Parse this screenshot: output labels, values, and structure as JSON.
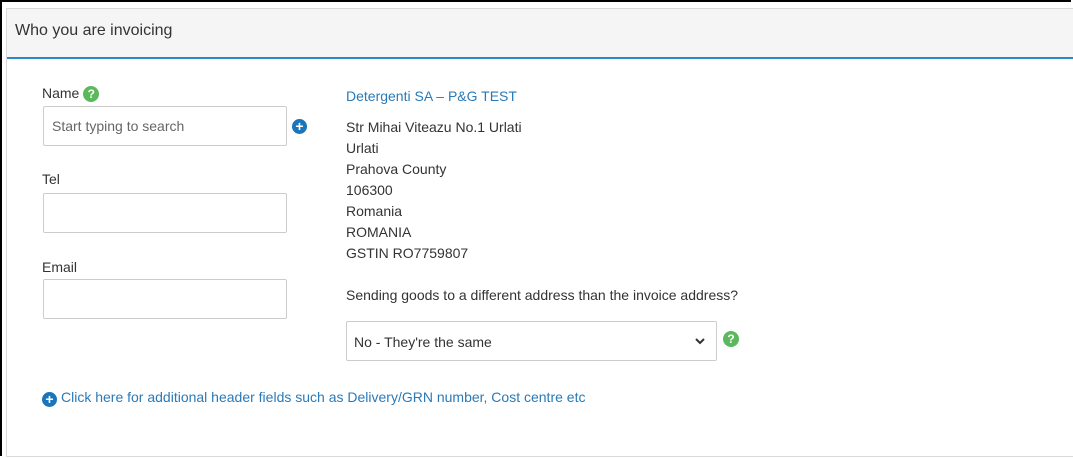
{
  "section": {
    "title": "Who you are invoicing"
  },
  "customer": {
    "name_label": "Name",
    "name_placeholder": "Start typing to search",
    "tel_label": "Tel",
    "email_label": "Email"
  },
  "address": {
    "company": "Detergenti SA – P&G TEST",
    "lines": [
      "Str Mihai Viteazu No.1 Urlati",
      "Urlati",
      "Prahova County",
      "106300",
      "Romania",
      "ROMANIA",
      "GSTIN RO7759807"
    ]
  },
  "delivery": {
    "question": "Sending goods to a different address than the invoice address?",
    "selected": "No - They're the same"
  },
  "more_fields_link": "Click here for additional header fields such as Delivery/GRN number, Cost centre etc",
  "icons": {
    "help": "question-circle-icon",
    "add": "plus-circle-icon",
    "dropdown": "chevron-down-icon"
  },
  "colors": {
    "accent": "#2a8ac7",
    "link": "#2a7ab8",
    "help_green": "#5cb85c",
    "add_blue": "#1b75bb"
  }
}
